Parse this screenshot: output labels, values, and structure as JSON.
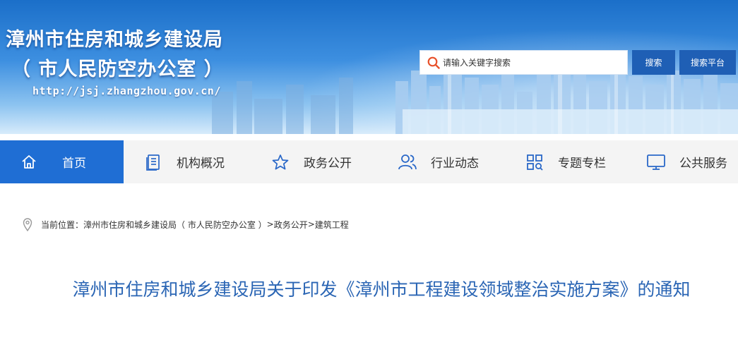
{
  "header": {
    "title_line1": "漳州市住房和城乡建设局",
    "title_line2": "（ 市人民防空办公室 ）",
    "url": "http://jsj.zhangzhou.gov.cn/",
    "search": {
      "placeholder": "请输入关键字搜索",
      "icon": "search-icon"
    },
    "search_button": "搜索",
    "platform_button": "搜索平台",
    "colors": {
      "banner_top": "#1b6fc9",
      "button": "#1f5fb5",
      "search_icon": "#e8512a"
    }
  },
  "nav": {
    "active_color": "#1f6ed4",
    "items": [
      {
        "label": "首页",
        "icon": "home-icon",
        "active": true
      },
      {
        "label": "机构概况",
        "icon": "document-list-icon",
        "active": false
      },
      {
        "label": "政务公开",
        "icon": "star-icon",
        "active": false
      },
      {
        "label": "行业动态",
        "icon": "users-icon",
        "active": false
      },
      {
        "label": "专题专栏",
        "icon": "grid-search-icon",
        "active": false
      },
      {
        "label": "公共服务",
        "icon": "monitor-icon",
        "active": false
      }
    ]
  },
  "breadcrumb": {
    "icon": "location-pin-icon",
    "prefix": "当前位置：",
    "items": [
      "漳州市住房和城乡建设局（ 市人民防空办公室 ）",
      "政务公开",
      "建筑工程"
    ],
    "separator": ">"
  },
  "article": {
    "title": "漳州市住房和城乡建设局关于印发《漳州市工程建设领域整治实施方案》的通知",
    "title_color": "#2a65b4"
  }
}
